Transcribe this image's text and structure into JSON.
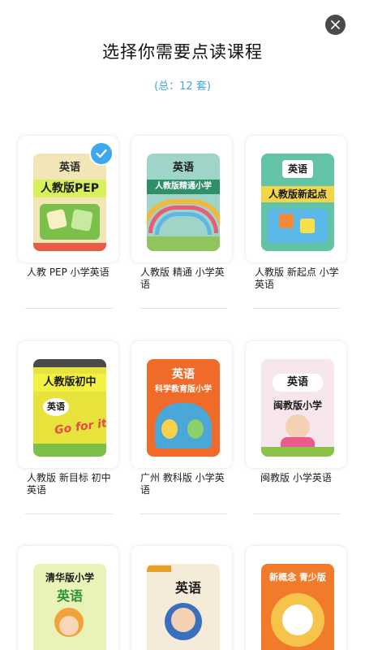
{
  "header": {
    "title": "选择你需要点读课程",
    "count": "(总：12 套)"
  },
  "courses": [
    {
      "label": "人教 PEP 小学英语",
      "cover_title": "英语",
      "cover_band": "人教版PEP",
      "selected": true,
      "colors": {
        "bg": "#f2e5b8",
        "band": "#d9f05a",
        "accent": "#7bc04a"
      }
    },
    {
      "label": "人教版 精通 小学英语",
      "cover_title": "英语",
      "cover_band": "人教版精通小学",
      "selected": false,
      "colors": {
        "bg": "#9fd4c9",
        "band": "#2f8f6a",
        "accent": "#f0b93c"
      }
    },
    {
      "label": "人教版 新起点 小学英语",
      "cover_title": "英语",
      "cover_band": "人教版新起点",
      "selected": false,
      "colors": {
        "bg": "#62c3a6",
        "band": "#f2d64a",
        "accent": "#5bb8e8"
      }
    },
    {
      "label": "人教版 新目标 初中英语",
      "cover_title": "英语",
      "cover_band": "人教版初中",
      "cover_extra": "Go for it!",
      "selected": false,
      "colors": {
        "bg": "#e8e23c",
        "band": "#f2f040",
        "accent": "#e94b45"
      }
    },
    {
      "label": "广州 教科版 小学英语",
      "cover_title": "英语",
      "cover_band": "科学教育版小学",
      "selected": false,
      "colors": {
        "bg": "#f06a2a",
        "band": "#f5902f",
        "accent": "#4aa8d8"
      }
    },
    {
      "label": "闽教版 小学英语",
      "cover_title": "英语",
      "cover_band": "闽教版小学",
      "selected": false,
      "colors": {
        "bg": "#f7e6ee",
        "band": "#ffffff",
        "accent": "#8bc34a"
      }
    },
    {
      "label": "",
      "cover_title": "英语",
      "cover_band": "清华版小学",
      "selected": false,
      "colors": {
        "bg": "#e9f3b8",
        "band": "#ffffff",
        "accent": "#f2a23a"
      }
    },
    {
      "label": "",
      "cover_title": "英语",
      "cover_band": "",
      "selected": false,
      "colors": {
        "bg": "#f4ecd8",
        "band": "#ffffff",
        "accent": "#e8a02a"
      }
    },
    {
      "label": "",
      "cover_title": "",
      "cover_band": "新概念 青少版",
      "selected": false,
      "colors": {
        "bg": "#f27a2b",
        "band": "#f27a2b",
        "accent": "#f6c44a"
      }
    }
  ],
  "icons": {
    "close": "close-icon",
    "check": "check-icon"
  }
}
